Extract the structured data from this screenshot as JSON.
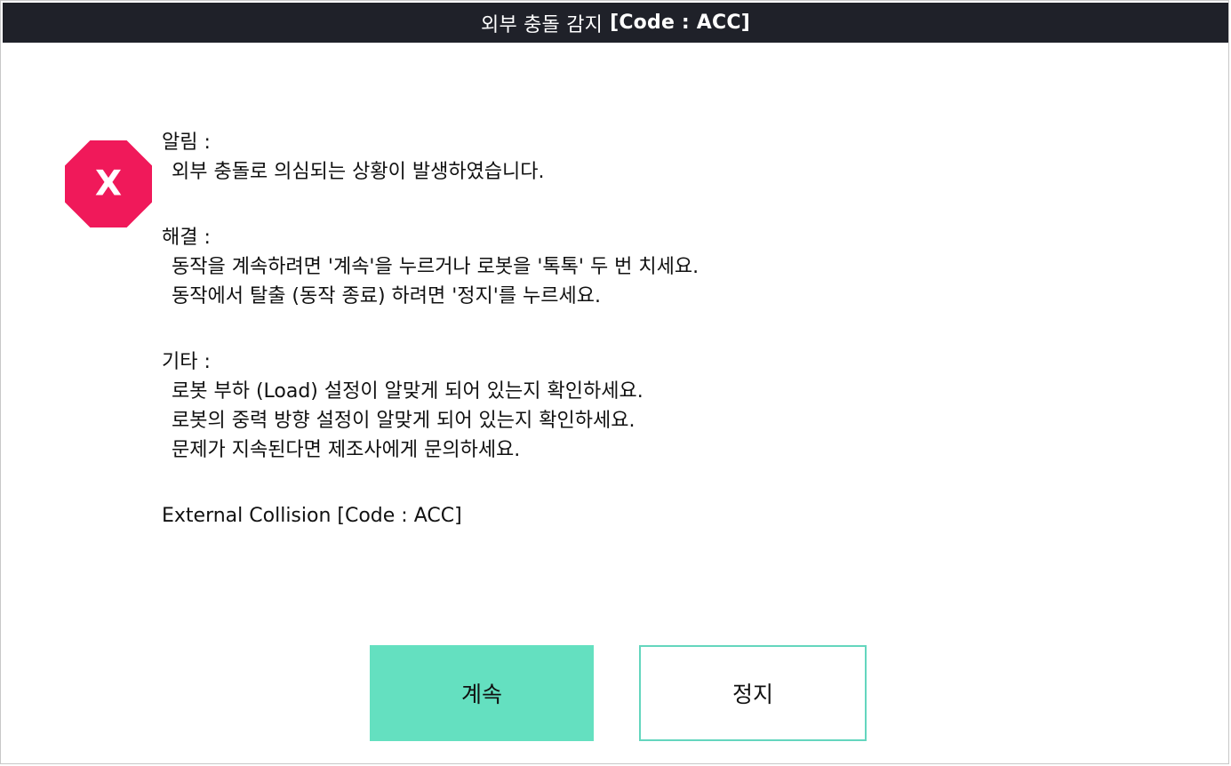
{
  "title": {
    "text": "외부 충돌 감지",
    "code": "[Code : ACC]"
  },
  "icon": {
    "name": "error-octagon-icon",
    "glyph": "X",
    "color": "#f0195a"
  },
  "notice": {
    "heading": "알림 :",
    "lines": [
      "외부 충돌로 의심되는 상황이 발생하였습니다."
    ]
  },
  "solution": {
    "heading": "해결 :",
    "lines": [
      "동작을 계속하려면 '계속'을 누르거나 로봇을 '톡톡' 두 번 치세요.",
      "동작에서 탈출 (동작 종료) 하려면 '정지'를 누르세요."
    ]
  },
  "other": {
    "heading": "기타 :",
    "lines": [
      "로봇 부하 (Load) 설정이 알맞게 되어 있는지 확인하세요.",
      "로봇의 중력 방향 설정이 알맞게 되어 있는지 확인하세요.",
      "문제가 지속된다면 제조사에게 문의하세요."
    ]
  },
  "english_code": "External Collision [Code : ACC]",
  "buttons": {
    "continue_label": "계속",
    "stop_label": "정지"
  },
  "colors": {
    "titlebar": "#1f2129",
    "accent": "#64e0c0",
    "error": "#f0195a"
  }
}
